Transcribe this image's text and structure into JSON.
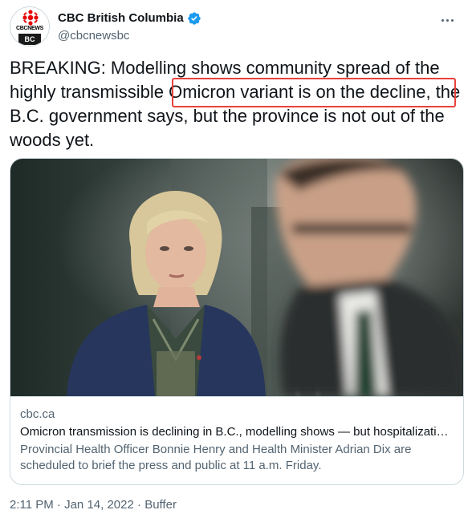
{
  "account": {
    "display_name": "CBC British Columbia",
    "handle": "@cbcnewsbc",
    "avatar_brand": "CBCNEWS",
    "avatar_region": "BC",
    "verified": true
  },
  "tweet": {
    "text_before": "BREAKING: Modelling shows community spread of the highly transmissible ",
    "text_highlight": "Omicron variant is on the decline,",
    "text_after": " the B.C. government says, but the province is not out of the woods yet."
  },
  "card": {
    "domain": "cbc.ca",
    "title": "Omicron transmission is declining in B.C., modelling shows — but hospitalizati…",
    "description": "Provincial Health Officer Bonnie Henry and Health Minister Adrian Dix are scheduled to brief the press and public at 11 a.m. Friday."
  },
  "meta": {
    "time": "2:11 PM",
    "separator": " · ",
    "date": "Jan 14, 2022",
    "source": "Buffer"
  },
  "colors": {
    "highlight_border": "#e8413c",
    "verified": "#1d9bf0",
    "cbc_red": "#e60505"
  },
  "icons": {
    "verified": "verified-badge-icon",
    "more": "more-options-icon",
    "logo": "cbc-gem-logo-icon"
  }
}
